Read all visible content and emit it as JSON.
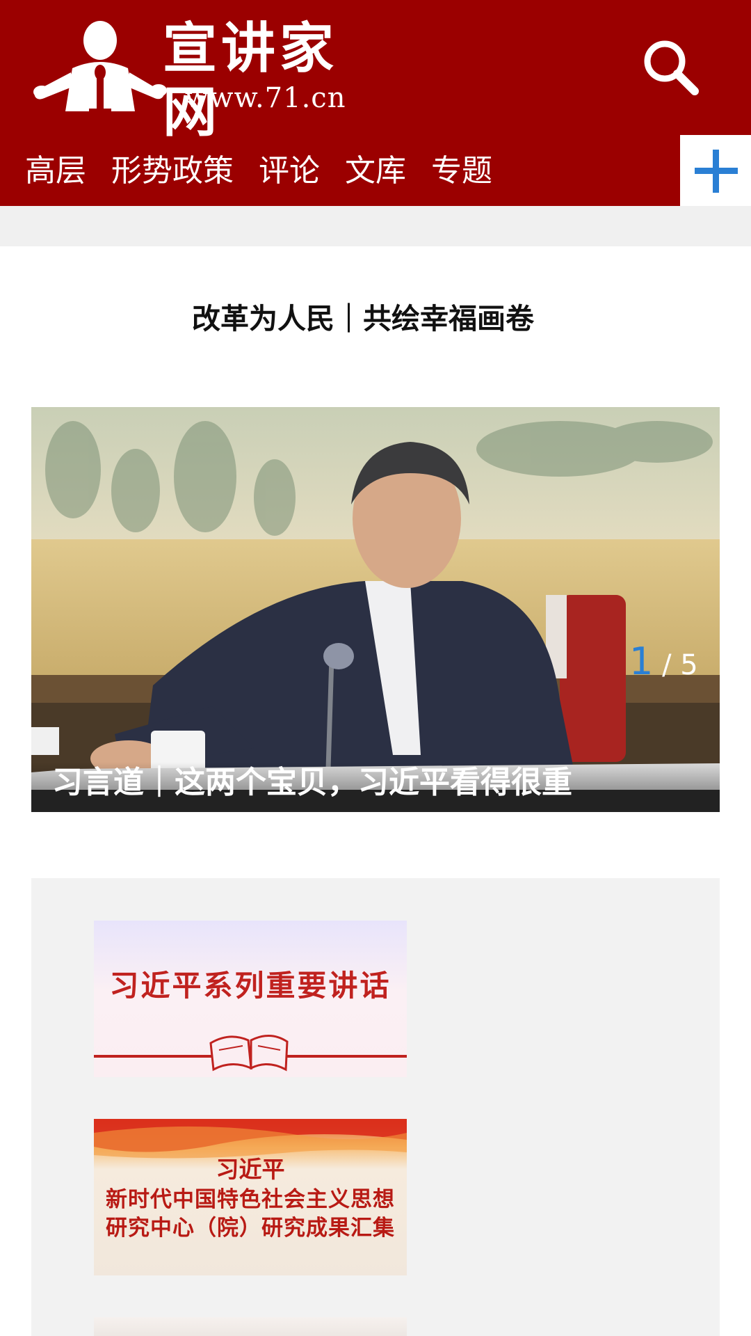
{
  "header": {
    "logo_title": "宣讲家网",
    "logo_url": "www.71.cn",
    "search_icon": "search-icon",
    "more_icon": "plus-icon",
    "colors": {
      "brand": "#9b0000",
      "accent": "#2a7fd4"
    }
  },
  "nav": {
    "items": [
      "高层",
      "形势政策",
      "评论",
      "文库",
      "专题"
    ]
  },
  "headline": "改革为人民｜共绘幸福画卷",
  "carousel": {
    "caption": "习言道｜这两个宝贝，习近平看得很重",
    "current": "1",
    "separator": " / ",
    "total": "5"
  },
  "banners": [
    {
      "title": "习近平系列重要讲话"
    },
    {
      "lines": [
        "习近平",
        "新时代中国特色社会主义思想",
        "研究中心（院）研究成果汇集"
      ]
    }
  ]
}
